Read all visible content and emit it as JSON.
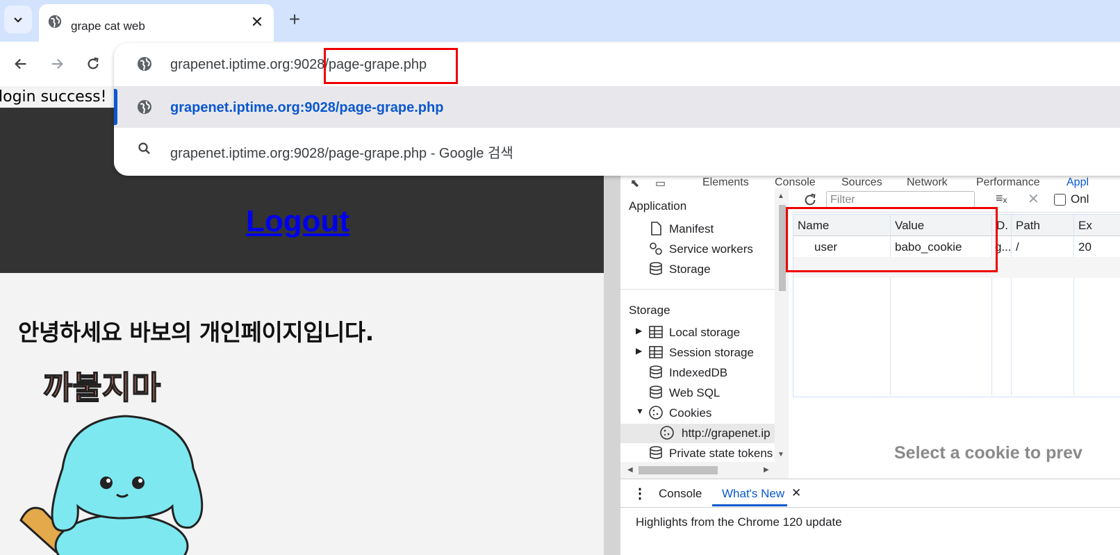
{
  "tab": {
    "title": "grape cat web",
    "close_glyph": "✕",
    "new_tab_glyph": "+"
  },
  "omnibox": {
    "input_text": "grapenet.iptime.org:9028/page-grape.php",
    "suggestion_url": "grapenet.iptime.org:9028/page-grape.php",
    "suggestion_search": "grapenet.iptime.org:9028/page-grape.php - Google 검색"
  },
  "page": {
    "login_message": "login success!",
    "logout_label": "Logout",
    "greeting": "안녕하세요 바보의 개인페이지입니다.",
    "illustration_caption": "까불지마"
  },
  "devtools": {
    "tabs": [
      "Elements",
      "Console",
      "Sources",
      "Network",
      "Performance",
      "Appl"
    ],
    "sidebar": {
      "application_title": "Application",
      "application_items": [
        "Manifest",
        "Service workers",
        "Storage"
      ],
      "storage_title": "Storage",
      "storage_items": [
        "Local storage",
        "Session storage",
        "IndexedDB",
        "Web SQL",
        "Cookies"
      ],
      "cookie_origin": "http://grapenet.ip",
      "last_item": "Private state tokens"
    },
    "filter_placeholder": "Filter",
    "only_label": "Onl",
    "cookie_table": {
      "columns": [
        "Name",
        "Value",
        "D.",
        "Path",
        "Ex"
      ],
      "rows": [
        {
          "name": "user",
          "value": "babo_cookie",
          "domain": "g...",
          "path": "/",
          "expires": "20"
        }
      ]
    },
    "preview_message": "Select a cookie to prev",
    "drawer": {
      "tabs": [
        "Console",
        "What's New"
      ],
      "active": "What's New",
      "body": "Highlights from the Chrome 120 update"
    }
  },
  "colors": {
    "highlight": "#f00000",
    "link": "#0000ee",
    "accent": "#0b57d0"
  }
}
